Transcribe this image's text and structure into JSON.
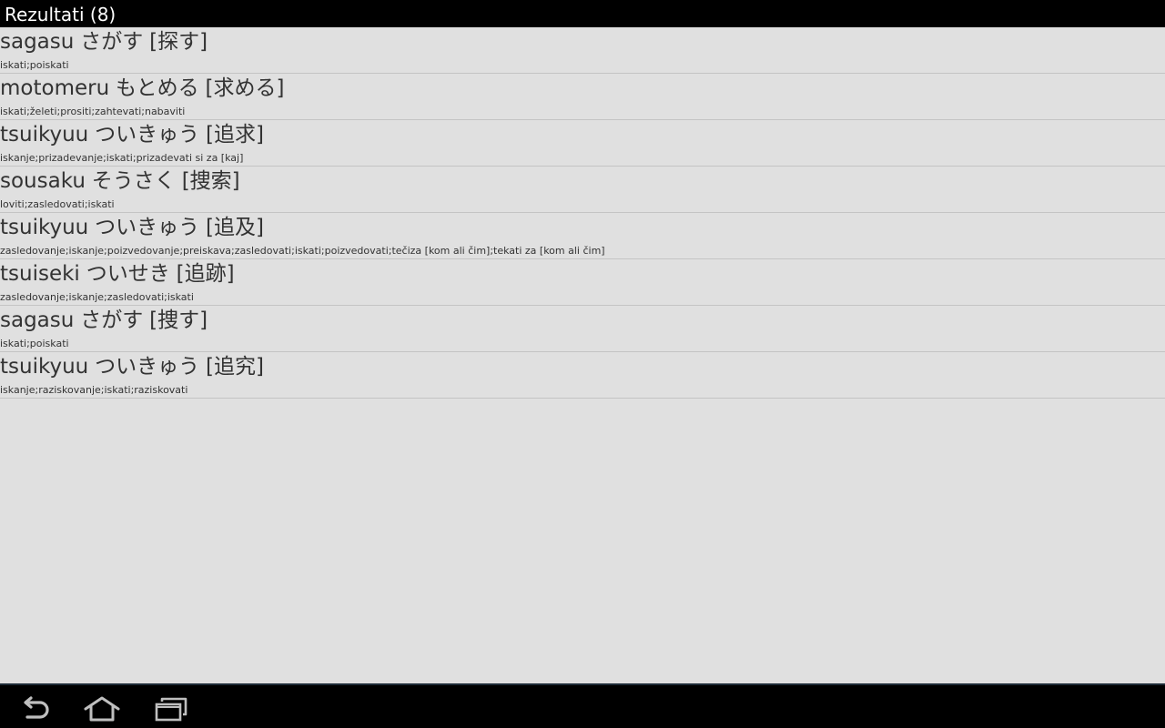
{
  "header": {
    "title": "Rezultati (8)"
  },
  "results": [
    {
      "romaji": "sagasu",
      "kana": "さがす",
      "kanji": "[探す]",
      "meaning": "iskati;poiskati"
    },
    {
      "romaji": "motomeru",
      "kana": "もとめる",
      "kanji": "[求める]",
      "meaning": "iskati;želeti;prositi;zahtevati;nabaviti"
    },
    {
      "romaji": "tsuikyuu",
      "kana": "ついきゅう",
      "kanji": "[追求]",
      "meaning": "iskanje;prizadevanje;iskati;prizadevati si za [kaj]"
    },
    {
      "romaji": "sousaku",
      "kana": "そうさく",
      "kanji": "[捜索]",
      "meaning": "loviti;zasledovati;iskati"
    },
    {
      "romaji": "tsuikyuu",
      "kana": "ついきゅう",
      "kanji": "[追及]",
      "meaning": "zasledovanje;iskanje;poizvedovanje;preiskava;zasledovati;iskati;poizvedovati;tečiza [kom ali čim];tekati za [kom ali čim]"
    },
    {
      "romaji": "tsuiseki",
      "kana": "ついせき",
      "kanji": "[追跡]",
      "meaning": "zasledovanje;iskanje;zasledovati;iskati"
    },
    {
      "romaji": "sagasu",
      "kana": "さがす",
      "kanji": "[捜す]",
      "meaning": "iskati;poiskati"
    },
    {
      "romaji": "tsuikyuu",
      "kana": "ついきゅう",
      "kanji": "[追究]",
      "meaning": "iskanje;raziskovanje;iskati;raziskovati"
    }
  ],
  "navbar": {
    "icons": [
      "back-icon",
      "home-icon",
      "recent-apps-icon"
    ]
  },
  "colors": {
    "title_bar_bg": "#000000",
    "list_bg": "#e0e0e0",
    "text": "#333333",
    "divider": "#c4c4c4",
    "nav_icon": "#bfbfbf"
  }
}
